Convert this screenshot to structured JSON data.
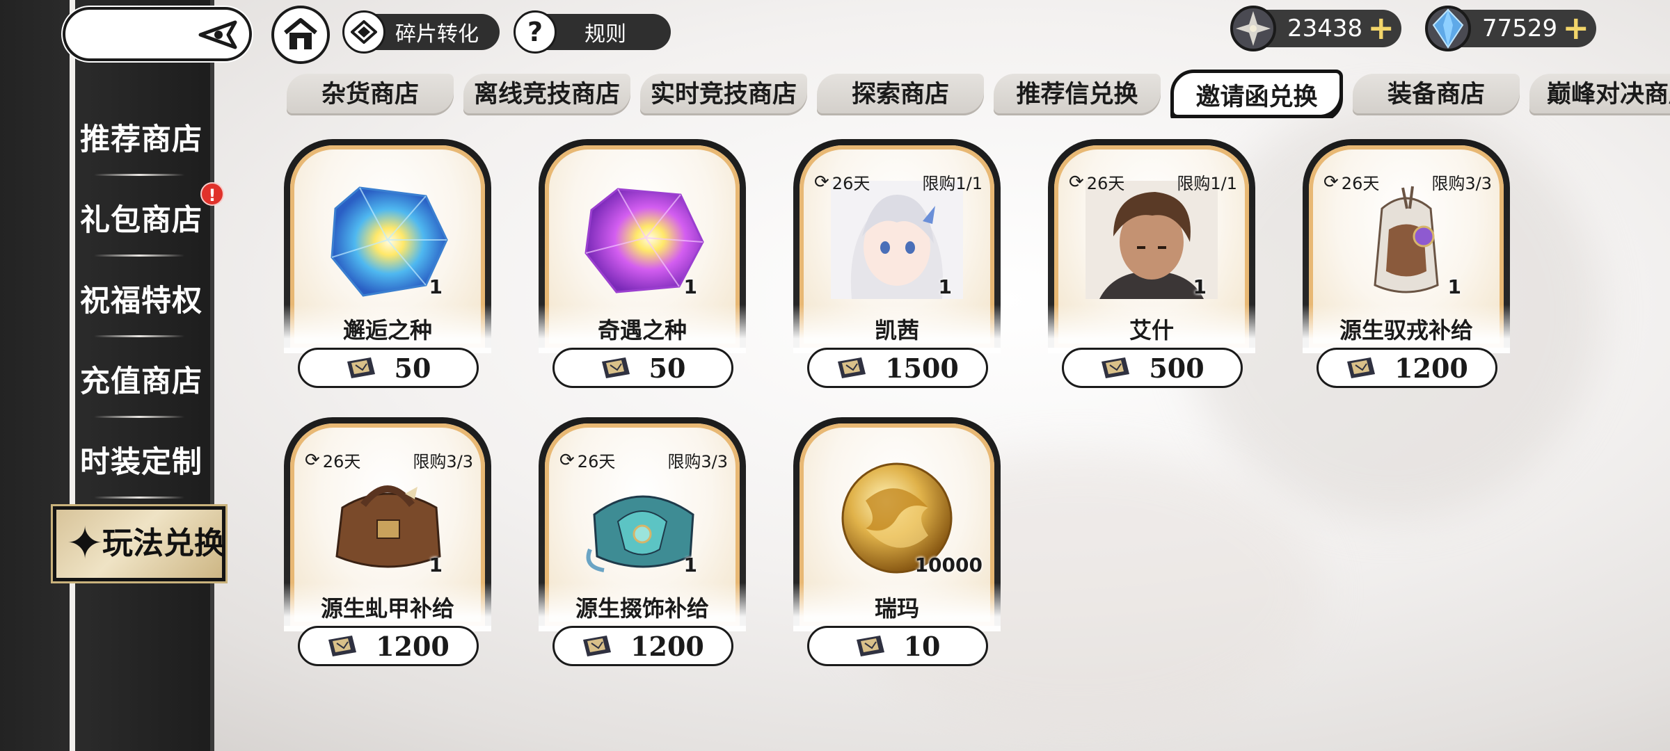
{
  "top": {
    "fragment_label": "碎片转化",
    "rules_label": "规则",
    "rules_icon": "?",
    "currency1": {
      "value": "23438",
      "plus": "+",
      "icon": "star-coin-icon"
    },
    "currency2": {
      "value": "77529",
      "plus": "+",
      "icon": "crystal-icon"
    }
  },
  "sidebar": {
    "items": [
      {
        "label": "推荐商店"
      },
      {
        "label": "礼包商店",
        "badge": "!"
      },
      {
        "label": "祝福特权"
      },
      {
        "label": "充值商店"
      },
      {
        "label": "时装定制"
      }
    ],
    "active": {
      "label": "玩法兑换",
      "icon": "✦"
    }
  },
  "tabs": [
    {
      "label": "杂货商店"
    },
    {
      "label": "离线竞技商店"
    },
    {
      "label": "实时竞技商店"
    },
    {
      "label": "探索商店"
    },
    {
      "label": "推荐信兑换"
    },
    {
      "label": "邀请函兑换",
      "active": true
    },
    {
      "label": "装备商店"
    },
    {
      "label": "巅峰对决商店"
    }
  ],
  "cards": [
    {
      "name": "邂逅之种",
      "price": "50",
      "qty": "1",
      "days": "",
      "limit": "",
      "art": "blue-crystal-icon"
    },
    {
      "name": "奇遇之种",
      "price": "50",
      "qty": "1",
      "days": "",
      "limit": "",
      "art": "purple-crystal-icon"
    },
    {
      "name": "凯茜",
      "price": "1500",
      "qty": "1",
      "days": "26天",
      "limit": "限购1/1",
      "art": "portrait-female-icon"
    },
    {
      "name": "艾什",
      "price": "500",
      "qty": "1",
      "days": "26天",
      "limit": "限购1/1",
      "art": "portrait-male-icon"
    },
    {
      "name": "源生驭戎补给",
      "price": "1200",
      "qty": "1",
      "days": "26天",
      "limit": "限购3/3",
      "art": "backpack-icon"
    },
    {
      "name": "源生虬甲补给",
      "price": "1200",
      "qty": "1",
      "days": "26天",
      "limit": "限购3/3",
      "art": "armor-bag-icon"
    },
    {
      "name": "源生掇饰补给",
      "price": "1200",
      "qty": "1",
      "days": "26天",
      "limit": "限购3/3",
      "art": "ornament-bag-icon"
    },
    {
      "name": "瑞玛",
      "price": "10",
      "qty": "10000",
      "days": "",
      "limit": "",
      "art": "gold-coin-icon"
    }
  ],
  "colors": {
    "accent": "#e8b874",
    "dark": "#1a1a1a",
    "badge": "#e0322b",
    "plus": "#f2d56a"
  }
}
